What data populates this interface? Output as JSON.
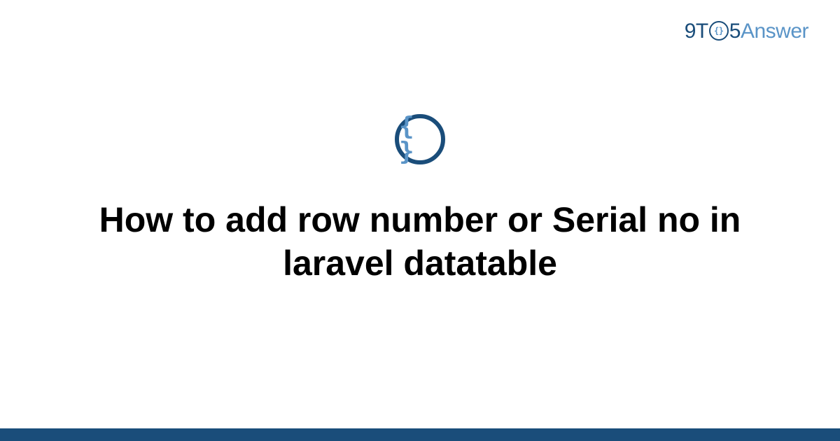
{
  "logo": {
    "part1": "9T",
    "part_o_inner": "{}",
    "part2": "5",
    "part3": "Answer"
  },
  "icon": {
    "braces": "{ }"
  },
  "title": "How to add row number or Serial no in laravel datatable",
  "colors": {
    "primary": "#1a4d7a",
    "secondary": "#5a94c7"
  }
}
